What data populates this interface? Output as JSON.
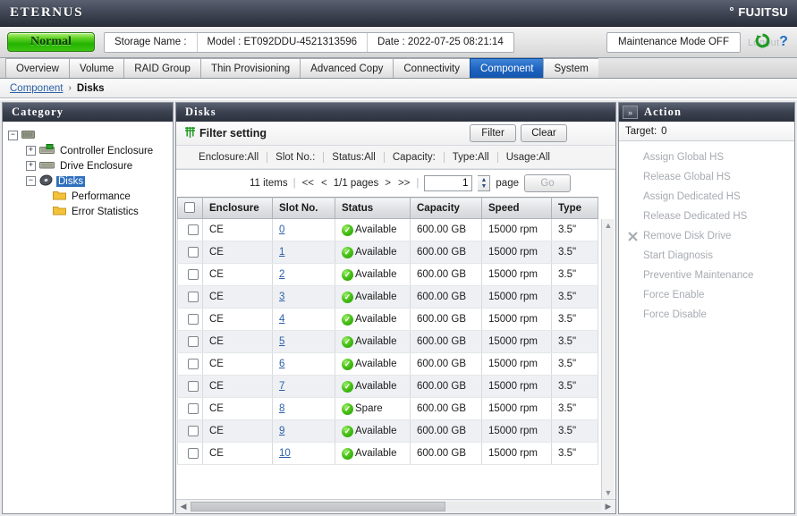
{
  "header": {
    "product": "ETERNUS",
    "vendor": "FUJITSU",
    "status_badge": "Normal",
    "storage_name_label": "Storage Name :",
    "model": "Model : ET092DDU-4521313596",
    "date": "Date : 2022-07-25 08:21:14",
    "maintenance_mode": "Maintenance Mode OFF",
    "ghost_logout": "Logout",
    "refresh_icon": "refresh-icon",
    "help_icon": "help-icon"
  },
  "tabs": [
    {
      "label": "Overview",
      "active": false
    },
    {
      "label": "Volume",
      "active": false
    },
    {
      "label": "RAID Group",
      "active": false
    },
    {
      "label": "Thin Provisioning",
      "active": false
    },
    {
      "label": "Advanced Copy",
      "active": false
    },
    {
      "label": "Connectivity",
      "active": false
    },
    {
      "label": "Component",
      "active": true
    },
    {
      "label": "System",
      "active": false
    }
  ],
  "breadcrumb": {
    "parent": "Component",
    "separator": "›",
    "current": "Disks"
  },
  "sidebar": {
    "title": "Category",
    "nodes": [
      {
        "label": "",
        "level": 1,
        "expander": "−",
        "icon": "enclosure-icon",
        "selected": false
      },
      {
        "label": "Controller Enclosure",
        "level": 2,
        "expander": "+",
        "icon": "controller-enclosure-icon",
        "selected": false
      },
      {
        "label": "Drive Enclosure",
        "level": 2,
        "expander": "+",
        "icon": "drive-enclosure-icon",
        "selected": false
      },
      {
        "label": "Disks",
        "level": 2,
        "expander": "−",
        "icon": "disk-icon",
        "selected": true
      },
      {
        "label": "Performance",
        "level": 3,
        "expander": "",
        "icon": "folder-icon",
        "selected": false
      },
      {
        "label": "Error Statistics",
        "level": 3,
        "expander": "",
        "icon": "folder-icon",
        "selected": false
      }
    ]
  },
  "main": {
    "title": "Disks",
    "filter": {
      "icon": "filter-icon",
      "title": "Filter setting",
      "filter_button": "Filter",
      "clear_button": "Clear",
      "criteria": [
        "Enclosure:All",
        "Slot No.:",
        "Status:All",
        "Capacity:",
        "Type:All",
        "Usage:All"
      ]
    },
    "pager": {
      "items_text": "11 items",
      "first": "<<",
      "prev": "<",
      "pages_text": "1/1 pages",
      "next": ">",
      "last": ">>",
      "page_value": "1",
      "page_label": "page",
      "go_button": "Go"
    },
    "table": {
      "columns": [
        "Enclosure",
        "Slot No.",
        "Status",
        "Capacity",
        "Speed",
        "Type"
      ],
      "rows": [
        {
          "enclosure": "CE",
          "slot": "0",
          "status": "Available",
          "capacity": "600.00 GB",
          "speed": "15000 rpm",
          "type": "3.5\""
        },
        {
          "enclosure": "CE",
          "slot": "1",
          "status": "Available",
          "capacity": "600.00 GB",
          "speed": "15000 rpm",
          "type": "3.5\""
        },
        {
          "enclosure": "CE",
          "slot": "2",
          "status": "Available",
          "capacity": "600.00 GB",
          "speed": "15000 rpm",
          "type": "3.5\""
        },
        {
          "enclosure": "CE",
          "slot": "3",
          "status": "Available",
          "capacity": "600.00 GB",
          "speed": "15000 rpm",
          "type": "3.5\""
        },
        {
          "enclosure": "CE",
          "slot": "4",
          "status": "Available",
          "capacity": "600.00 GB",
          "speed": "15000 rpm",
          "type": "3.5\""
        },
        {
          "enclosure": "CE",
          "slot": "5",
          "status": "Available",
          "capacity": "600.00 GB",
          "speed": "15000 rpm",
          "type": "3.5\""
        },
        {
          "enclosure": "CE",
          "slot": "6",
          "status": "Available",
          "capacity": "600.00 GB",
          "speed": "15000 rpm",
          "type": "3.5\""
        },
        {
          "enclosure": "CE",
          "slot": "7",
          "status": "Available",
          "capacity": "600.00 GB",
          "speed": "15000 rpm",
          "type": "3.5\""
        },
        {
          "enclosure": "CE",
          "slot": "8",
          "status": "Spare",
          "capacity": "600.00 GB",
          "speed": "15000 rpm",
          "type": "3.5\""
        },
        {
          "enclosure": "CE",
          "slot": "9",
          "status": "Available",
          "capacity": "600.00 GB",
          "speed": "15000 rpm",
          "type": "3.5\""
        },
        {
          "enclosure": "CE",
          "slot": "10",
          "status": "Available",
          "capacity": "600.00 GB",
          "speed": "15000 rpm",
          "type": "3.5\""
        }
      ]
    }
  },
  "action": {
    "collapse_icon": "»",
    "title": "Action",
    "target_label": "Target:",
    "target_count": "0",
    "items": [
      {
        "label": "Assign Global HS",
        "icon": ""
      },
      {
        "label": "Release Global HS",
        "icon": ""
      },
      {
        "label": "Assign Dedicated HS",
        "icon": ""
      },
      {
        "label": "Release Dedicated HS",
        "icon": ""
      },
      {
        "label": "Remove Disk Drive",
        "icon": "remove-x-icon"
      },
      {
        "label": "Start Diagnosis",
        "icon": ""
      },
      {
        "label": "Preventive Maintenance",
        "icon": ""
      },
      {
        "label": "Force Enable",
        "icon": ""
      },
      {
        "label": "Force Disable",
        "icon": ""
      }
    ]
  },
  "colors": {
    "accent_blue": "#1f64c0",
    "status_green": "#23b400",
    "header_dark": "#3d4352",
    "link_blue": "#2b5fa8"
  }
}
